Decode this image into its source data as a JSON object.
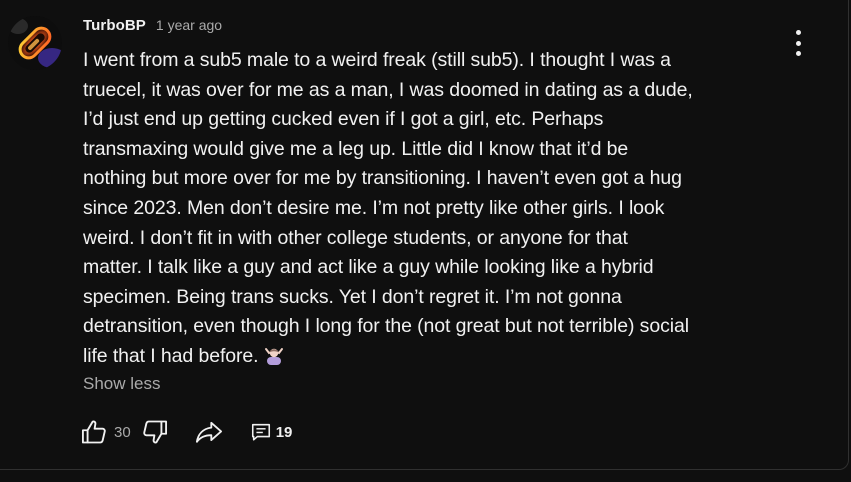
{
  "comment": {
    "author": "TurboBP",
    "timestamp": "1 year ago",
    "text": "I went from a sub5 male to a weird freak (still sub5). I thought I was a\ntruecel, it was over for me as a man, I was doomed in dating as a dude,\nI’d just end up getting cucked even if I got a girl, etc. Perhaps\ntransmaxing would give me a leg up. Little did I know that it’d be\nnothing but more over for me by transitioning. I haven’t even got a hug\nsince 2023. Men don’t desire me. I’m not pretty like other girls. I look\nweird. I don’t fit in with other college students, or anyone for that\nmatter. I talk like a guy and act like a guy while looking like a hybrid\nspecimen. Being trans sucks. Yet I don’t regret it. I’m not gonna\ndetransition, even though I long for the (not great but not terrible) social\nlife that I had before.",
    "emoji_icon": "person-shrugging-emoji",
    "show_less_label": "Show less",
    "like_count": "30",
    "reply_count": "19"
  },
  "icons": {
    "avatar": "avatar-image",
    "more": "more-vertical-icon",
    "like": "thumbs-up-icon",
    "dislike": "thumbs-down-icon",
    "share": "share-arrow-icon",
    "replies": "comment-bubble-icon"
  },
  "colors": {
    "background": "#0f0f0f",
    "text_primary": "#f1f1f1",
    "text_secondary": "#aaaaaa"
  }
}
